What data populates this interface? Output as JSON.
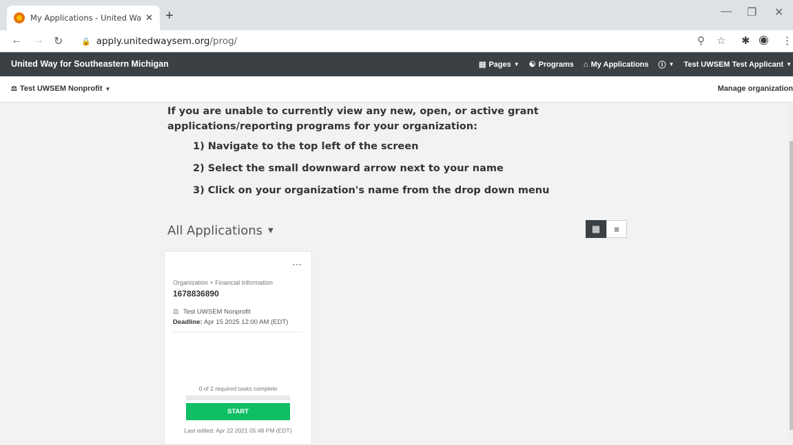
{
  "browser": {
    "tab_title": "My Applications - United Way fo",
    "tab_close": "✕",
    "new_tab": "+",
    "url_host": "apply.unitedwaysem.org",
    "url_path": "/prog/"
  },
  "navbar": {
    "brand": "United Way for Southeastern Michigan",
    "pages": "Pages",
    "programs": "Programs",
    "my_applications": "My Applications",
    "user": "Test UWSEM Test Applicant"
  },
  "orgbar": {
    "org_name": "Test UWSEM Nonprofit",
    "manage": "Manage organization"
  },
  "instructions": {
    "intro": "If you are unable to currently view any new, open, or active grant applications/reporting programs for your organization:",
    "steps": [
      "1) Navigate to the top left of the screen",
      "2) Select the small downward arrow next to your name",
      "3) Click on your organization's name from the drop down menu"
    ]
  },
  "applications": {
    "title": "All Applications",
    "cards": [
      {
        "category": "Organization + Financial Information",
        "id": "1678836890",
        "org": "Test UWSEM Nonprofit",
        "deadline_label": "Deadline:",
        "deadline_value": "Apr 15 2025 12:00 AM (EDT)",
        "tasks": "0 of 2 required tasks complete",
        "progress": 0,
        "start_label": "START",
        "last_edited": "Last edited: Apr 22 2021 05:48 PM (EDT)"
      }
    ]
  },
  "colors": {
    "navbar": "#3a4044",
    "start_button": "#0fbf66"
  },
  "icons": [
    "favicon-icon",
    "back-icon",
    "forward-icon",
    "reload-icon",
    "lock-icon",
    "zoom-icon",
    "star-icon",
    "extensions-icon",
    "profile-icon",
    "menu-icon",
    "pages-icon",
    "programs-icon",
    "home-icon",
    "info-icon",
    "org-icon",
    "grid-view-icon",
    "list-view-icon",
    "more-icon"
  ]
}
